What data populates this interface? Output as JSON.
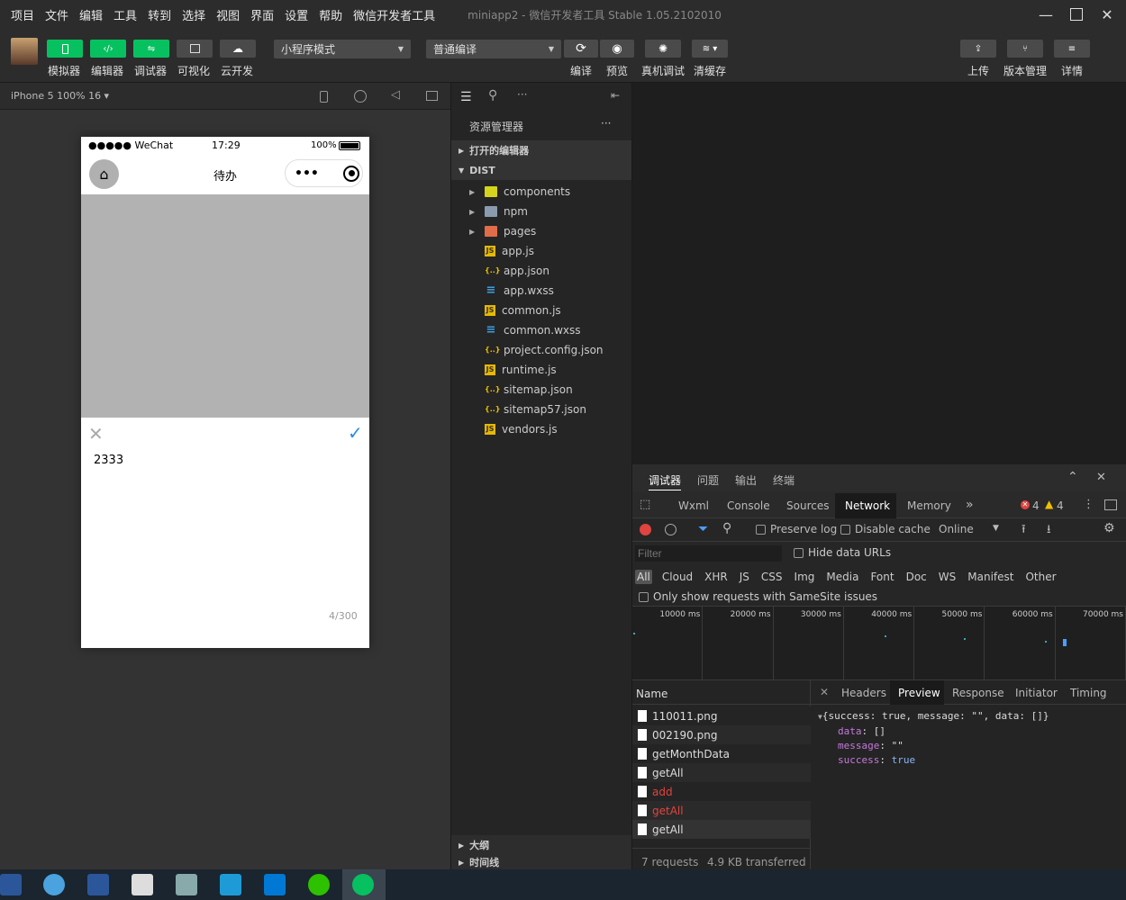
{
  "menubar": {
    "items": [
      "项目",
      "文件",
      "编辑",
      "工具",
      "转到",
      "选择",
      "视图",
      "界面",
      "设置",
      "帮助",
      "微信开发者工具"
    ],
    "title": "miniapp2 - 微信开发者工具 Stable 1.05.2102010"
  },
  "toolbar": {
    "simulator": "模拟器",
    "editor": "编辑器",
    "debugger": "调试器",
    "visual": "可视化",
    "cloud": "云开发",
    "mode": "小程序模式",
    "compile_mode": "普通编译",
    "compile": "编译",
    "preview": "预览",
    "remote_debug": "真机调试",
    "clear_cache": "清缓存",
    "upload": "上传",
    "version": "版本管理",
    "details": "详情"
  },
  "device": {
    "label": "iPhone 5 100% 16 ▾"
  },
  "phone": {
    "signal": "●●●●● WeChat",
    "time": "17:29",
    "battery": "100%",
    "nav_title": "待办",
    "capsule_dots": "•••",
    "text": "2333",
    "counter": "4/300"
  },
  "explorer": {
    "title": "资源管理器",
    "more": "···",
    "open_editors": "打开的编辑器",
    "root": "DIST",
    "files": [
      {
        "name": "components",
        "icon": "folder-components"
      },
      {
        "name": "npm",
        "icon": "folder"
      },
      {
        "name": "pages",
        "icon": "folder-pages"
      },
      {
        "name": "app.js",
        "icon": "js"
      },
      {
        "name": "app.json",
        "icon": "json"
      },
      {
        "name": "app.wxss",
        "icon": "wxss"
      },
      {
        "name": "common.js",
        "icon": "js"
      },
      {
        "name": "common.wxss",
        "icon": "wxss"
      },
      {
        "name": "project.config.json",
        "icon": "json"
      },
      {
        "name": "runtime.js",
        "icon": "js"
      },
      {
        "name": "sitemap.json",
        "icon": "json"
      },
      {
        "name": "sitemap57.json",
        "icon": "json"
      },
      {
        "name": "vendors.js",
        "icon": "js"
      }
    ],
    "outline": "大纲",
    "timeline": "时间线"
  },
  "devtools": {
    "top_tabs": [
      "调试器",
      "问题",
      "输出",
      "终端"
    ],
    "panel_tabs": [
      "Wxml",
      "Console",
      "Sources",
      "Network",
      "Memory"
    ],
    "more_tabs": "»",
    "errors": "4",
    "warnings": "4",
    "preserve_log": "Preserve log",
    "disable_cache": "Disable cache",
    "throttle": "Online",
    "filter_placeholder": "Filter",
    "hide_data_urls": "Hide data URLs",
    "types": [
      "All",
      "Cloud",
      "XHR",
      "JS",
      "CSS",
      "Img",
      "Media",
      "Font",
      "Doc",
      "WS",
      "Manifest",
      "Other"
    ],
    "samesite": "Only show requests with SameSite issues",
    "timeline_ticks": [
      "10000 ms",
      "20000 ms",
      "30000 ms",
      "40000 ms",
      "50000 ms",
      "60000 ms",
      "70000 ms"
    ],
    "name_header": "Name",
    "requests": [
      {
        "name": "110011.png",
        "error": false
      },
      {
        "name": "002190.png",
        "error": false
      },
      {
        "name": "getMonthData",
        "error": false
      },
      {
        "name": "getAll",
        "error": false
      },
      {
        "name": "add",
        "error": true
      },
      {
        "name": "getAll",
        "error": true
      },
      {
        "name": "getAll",
        "error": false
      }
    ],
    "detail_tabs": [
      "Headers",
      "Preview",
      "Response",
      "Initiator",
      "Timing"
    ],
    "preview_root": "{success: true, message: \"\", data: []}",
    "preview_lines": [
      {
        "key": "data",
        "value": "[]"
      },
      {
        "key": "message",
        "value": "\"\""
      },
      {
        "key": "success",
        "value": "true"
      }
    ],
    "status_requests": "7 requests",
    "status_transferred": "4.9 KB transferred"
  },
  "colors": {
    "accent": "#07c160",
    "error": "#e0443e",
    "bg": "#2c2c2c"
  }
}
